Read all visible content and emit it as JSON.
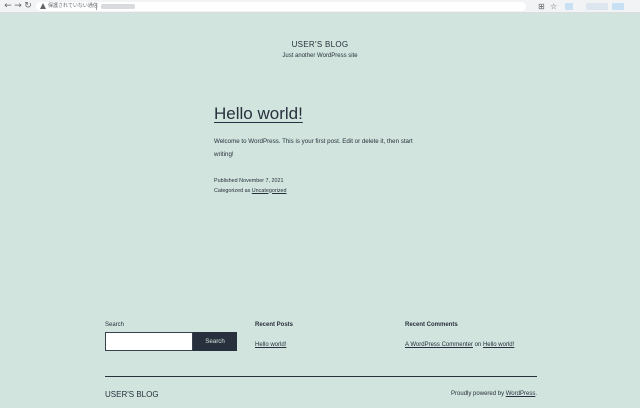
{
  "browser": {
    "back_glyph": "←",
    "forward_glyph": "→",
    "reload_glyph": "↻",
    "security_text": "保護されていない通信",
    "translate_glyph": "⊞",
    "star_glyph": "☆",
    "colors": {
      "toolbar": "#f1f3f4",
      "ext_blue": "#c7e0f4"
    }
  },
  "header": {
    "site_title": "USER'S BLOG",
    "site_description": "Just another WordPress site"
  },
  "post": {
    "title": "Hello world!",
    "body": "Welcome to WordPress. This is your first post. Edit or delete it, then start writing!",
    "published": "Published November 7, 2021",
    "categorized_prefix": "Categorized as ",
    "category": "Uncategorized"
  },
  "widgets": {
    "search": {
      "label": "Search",
      "input_value": "",
      "button_label": "Search"
    },
    "recent_posts": {
      "heading": "Recent Posts",
      "items": [
        "Hello world!"
      ]
    },
    "recent_comments": {
      "heading": "Recent Comments",
      "author": "A WordPress Commenter",
      "connector": " on ",
      "post": "Hello world!"
    }
  },
  "footer": {
    "site_title": "USER'S BLOG",
    "powered_prefix": "Proudly powered by ",
    "powered_link": "WordPress",
    "powered_suffix": "."
  },
  "colors": {
    "background": "#d1e4dd",
    "text": "#28303d"
  }
}
